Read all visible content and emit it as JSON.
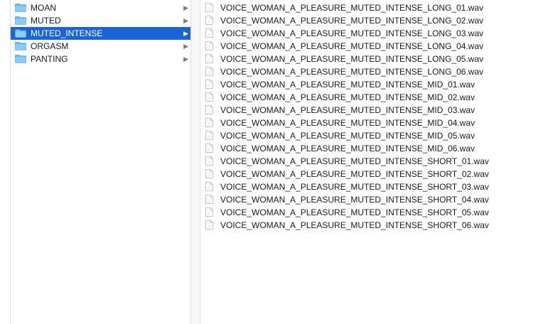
{
  "folders": [
    {
      "label": "MOAN",
      "selected": false
    },
    {
      "label": "MUTED",
      "selected": false
    },
    {
      "label": "MUTED_INTENSE",
      "selected": true
    },
    {
      "label": "ORGASM",
      "selected": false
    },
    {
      "label": "PANTING",
      "selected": false
    }
  ],
  "files": [
    "VOICE_WOMAN_A_PLEASURE_MUTED_INTENSE_LONG_01.wav",
    "VOICE_WOMAN_A_PLEASURE_MUTED_INTENSE_LONG_02.wav",
    "VOICE_WOMAN_A_PLEASURE_MUTED_INTENSE_LONG_03.wav",
    "VOICE_WOMAN_A_PLEASURE_MUTED_INTENSE_LONG_04.wav",
    "VOICE_WOMAN_A_PLEASURE_MUTED_INTENSE_LONG_05.wav",
    "VOICE_WOMAN_A_PLEASURE_MUTED_INTENSE_LONG_06.wav",
    "VOICE_WOMAN_A_PLEASURE_MUTED_INTENSE_MID_01.wav",
    "VOICE_WOMAN_A_PLEASURE_MUTED_INTENSE_MID_02.wav",
    "VOICE_WOMAN_A_PLEASURE_MUTED_INTENSE_MID_03.wav",
    "VOICE_WOMAN_A_PLEASURE_MUTED_INTENSE_MID_04.wav",
    "VOICE_WOMAN_A_PLEASURE_MUTED_INTENSE_MID_05.wav",
    "VOICE_WOMAN_A_PLEASURE_MUTED_INTENSE_MID_06.wav",
    "VOICE_WOMAN_A_PLEASURE_MUTED_INTENSE_SHORT_01.wav",
    "VOICE_WOMAN_A_PLEASURE_MUTED_INTENSE_SHORT_02.wav",
    "VOICE_WOMAN_A_PLEASURE_MUTED_INTENSE_SHORT_03.wav",
    "VOICE_WOMAN_A_PLEASURE_MUTED_INTENSE_SHORT_04.wav",
    "VOICE_WOMAN_A_PLEASURE_MUTED_INTENSE_SHORT_05.wav",
    "VOICE_WOMAN_A_PLEASURE_MUTED_INTENSE_SHORT_06.wav"
  ],
  "icons": {
    "folder": "folder-icon",
    "file": "audio-file-icon",
    "disclosure": "chevron-right-icon"
  },
  "colors": {
    "selection": "#1a64d6",
    "folder_fill": "#6bb8f2"
  }
}
